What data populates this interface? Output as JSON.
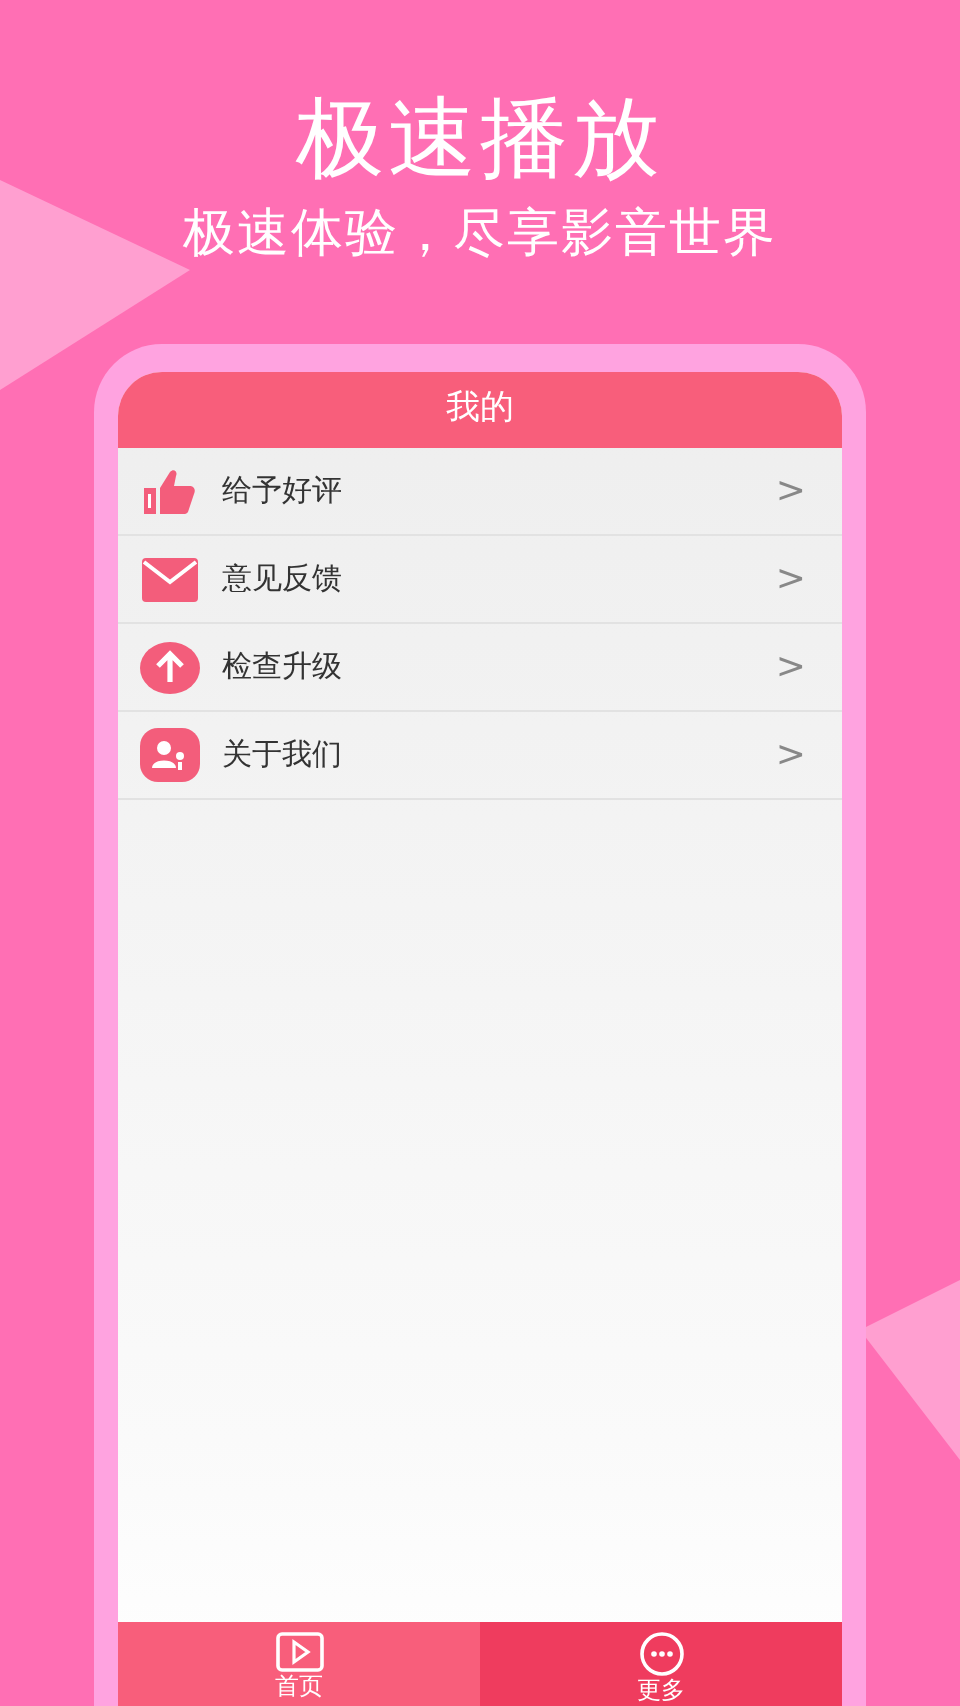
{
  "headline": "极速播放",
  "subtitle": "极速体验，尽享影音世界",
  "screen": {
    "title": "我的",
    "menu": [
      {
        "label": "给予好评",
        "chevron": ">"
      },
      {
        "label": "意见反馈",
        "chevron": ">"
      },
      {
        "label": "检查升级",
        "chevron": ">"
      },
      {
        "label": "关于我们",
        "chevron": ">"
      }
    ],
    "tabs": [
      {
        "label": "首页",
        "selected": false
      },
      {
        "label": "更多",
        "selected": true
      }
    ]
  }
}
